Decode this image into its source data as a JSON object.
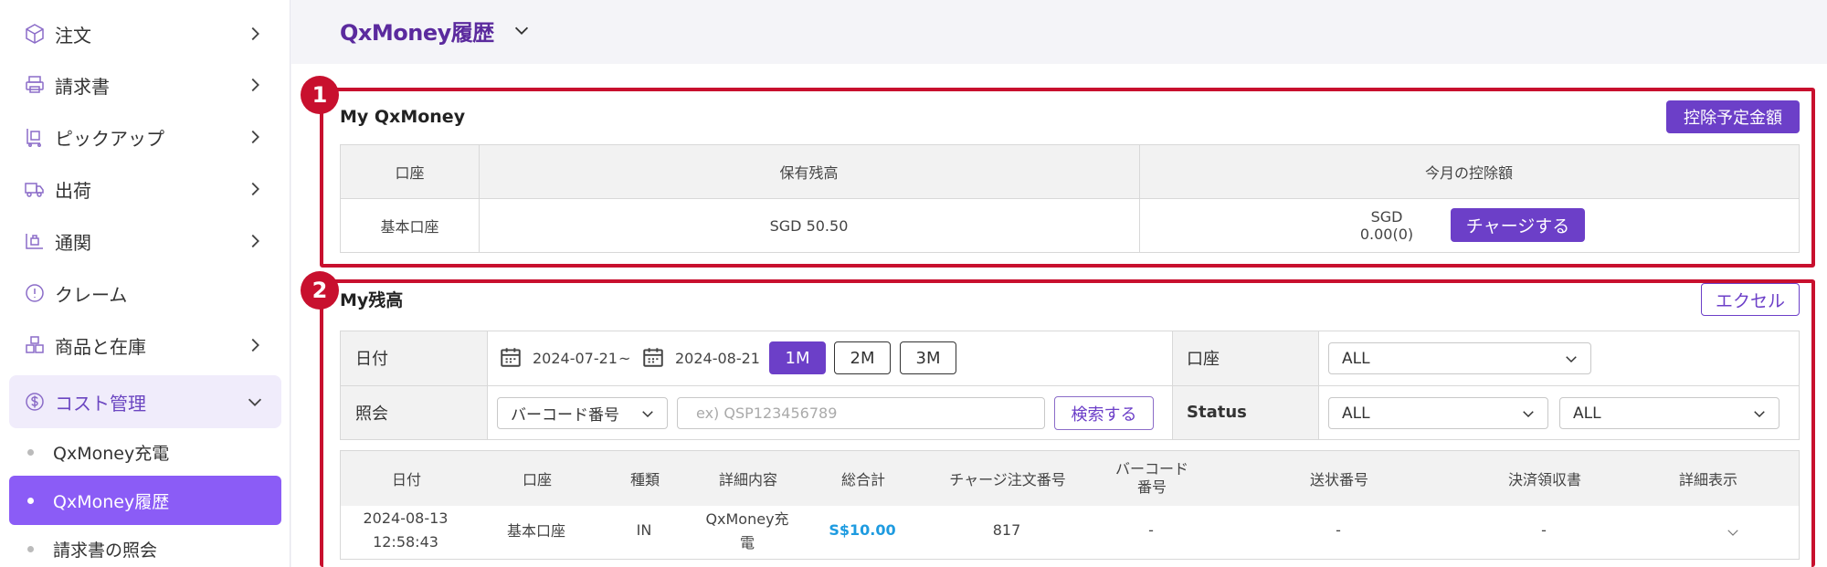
{
  "sidebar": {
    "items": [
      {
        "label": "注文",
        "icon": "box-icon"
      },
      {
        "label": "請求書",
        "icon": "printer-icon"
      },
      {
        "label": "ピックアップ",
        "icon": "cart-icon"
      },
      {
        "label": "出荷",
        "icon": "truck-icon"
      },
      {
        "label": "通関",
        "icon": "customs-icon"
      },
      {
        "label": "クレーム",
        "icon": "alert-circle-icon"
      },
      {
        "label": "商品と在庫",
        "icon": "boxes-icon"
      },
      {
        "label": "コスト管理",
        "icon": "dollar-circle-icon"
      }
    ],
    "sub_items": [
      "QxMoney充電",
      "QxMoney履歴",
      "請求書の照会"
    ]
  },
  "header": {
    "title": "QxMoney履歴"
  },
  "badges": [
    "1",
    "2"
  ],
  "my_qxmoney": {
    "title": "My QxMoney",
    "deduction_button": "控除予定金額",
    "columns": [
      "口座",
      "保有残高",
      "今月の控除額"
    ],
    "row": {
      "account": "基本口座",
      "balance": "SGD 50.50",
      "deduction": "SGD 0.00(0)"
    },
    "charge_button": "チャージする"
  },
  "my_balance": {
    "title": "My残高",
    "excel_button": "エクセル",
    "filters": {
      "date_label": "日付",
      "date_from": "2024-07-21",
      "tilde": "~",
      "date_to": "2024-08-21",
      "periods": [
        "1M",
        "2M",
        "3M"
      ],
      "account_label": "口座",
      "account_value": "ALL",
      "query_label": "照会",
      "query_type": "バーコード番号",
      "query_placeholder": "ex) QSP123456789",
      "search_button": "検索する",
      "status_label": "Status",
      "status_value_1": "ALL",
      "status_value_2": "ALL"
    },
    "columns": [
      "日付",
      "口座",
      "種類",
      "詳細内容",
      "総合計",
      "チャージ注文番号",
      "バーコード\n番号",
      "送状番号",
      "決済領収書",
      "詳細表示"
    ],
    "rows": [
      {
        "date": "2024-08-13",
        "time": "12:58:43",
        "account": "基本口座",
        "type": "IN",
        "detail_1": "QxMoney充",
        "detail_2": "電",
        "total": "S$10.00",
        "charge_order": "817",
        "barcode": "-",
        "invoice": "-",
        "receipt": "-"
      }
    ]
  },
  "colors": {
    "accent": "#6c3fc8",
    "highlight": "#c8102e",
    "active_nav": "#8b5cf6",
    "total_link": "#1e9be0"
  }
}
